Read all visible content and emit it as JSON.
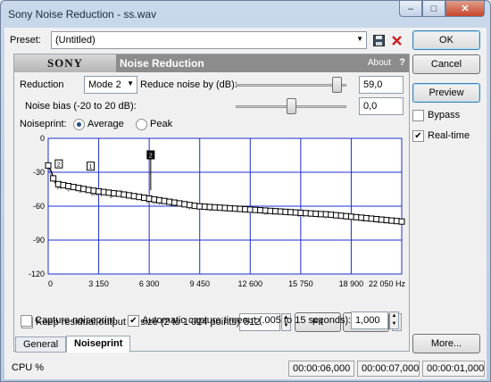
{
  "window": {
    "title": "Sony Noise Reduction - ss.wav"
  },
  "titlebar_buttons": {
    "minimize": "–",
    "maximize": "□",
    "close": "✕"
  },
  "preset": {
    "label": "Preset:",
    "value": "(Untitled)"
  },
  "buttons": {
    "ok": "OK",
    "cancel": "Cancel",
    "preview": "Preview",
    "more": "More...",
    "fit": "Fit",
    "reset": "Reset"
  },
  "options": {
    "bypass": {
      "label": "Bypass",
      "checked": false
    },
    "realtime": {
      "label": "Real-time",
      "checked": true
    }
  },
  "plugin": {
    "brand": "SONY",
    "name": "Noise Reduction",
    "about": "About",
    "help": "?"
  },
  "reduction": {
    "label": "Reduction",
    "mode": "Mode 2",
    "reduce_label": "Reduce noise by (dB):",
    "reduce_value": "59,0",
    "reduce_level": 0.91
  },
  "noise_bias": {
    "label": "Noise bias (-20 to 20 dB):",
    "value": "0,0",
    "level": 0.5
  },
  "noiseprint": {
    "label": "Noiseprint:",
    "average": {
      "label": "Average",
      "selected": true
    },
    "peak": {
      "label": "Peak",
      "selected": false
    }
  },
  "graph": {
    "y_ticks": [
      "0",
      "-30",
      "-60",
      "-90",
      "-120"
    ],
    "x_ticks": [
      "0",
      "3 150",
      "6 300",
      "9 450",
      "12 600",
      "15 750",
      "18 900",
      "22 050 Hz"
    ],
    "y_range": [
      -120,
      0
    ],
    "x_range": [
      0,
      22050
    ],
    "markers": [
      "2",
      "1",
      "2"
    ]
  },
  "keep_residual": {
    "label": "Keep residual output",
    "checked": false
  },
  "fit_size": {
    "label": "Fit size (2 to 1 024 points):",
    "value": "512"
  },
  "capture": {
    "label": "Capture noiseprint",
    "checked": false,
    "auto_label": "Automatic capture timeout (.005 to 15 seconds):",
    "auto_checked": true,
    "timeout": "1,000"
  },
  "tabs": [
    "General",
    "Noiseprint"
  ],
  "status": {
    "label": "CPU %",
    "t1": "00:00:06,000",
    "t2": "00:00:07,000",
    "t3": "00:00:01,000"
  },
  "colors": {
    "graph_grid": "#1c2fd0",
    "header_gray": "#8c8c8c",
    "curve": "#000000"
  }
}
